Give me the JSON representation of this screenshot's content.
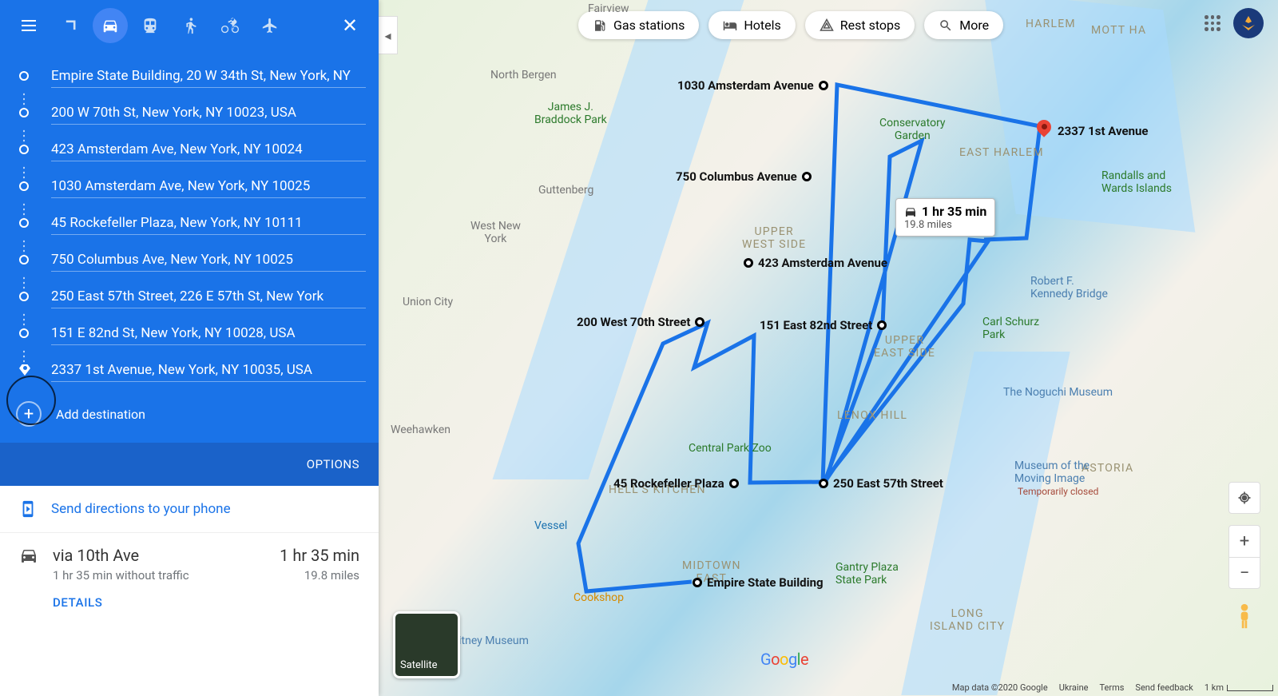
{
  "travel_modes": [
    "best",
    "driving",
    "transit",
    "walking",
    "cycling",
    "flights"
  ],
  "waypoints": [
    "Empire State Building, 20 W 34th St, New York, NY",
    "200 W 70th St, New York, NY 10023, USA",
    "423 Amsterdam Ave, New York, NY 10024",
    "1030 Amsterdam Ave, New York, NY 10025",
    "45 Rockefeller Plaza, New York, NY 10111",
    "750 Columbus Ave, New York, NY 10025",
    "250 East 57th Street, 226 E 57th St, New York",
    "151 E 82nd St, New York, NY 10028, USA",
    "2337 1st Avenue, New York, NY 10035, USA"
  ],
  "add_destination_label": "Add destination",
  "options_label": "OPTIONS",
  "send_label": "Send directions to your phone",
  "route": {
    "title": "via 10th Ave",
    "time": "1 hr 35 min",
    "subtitle": "1 hr 35 min without traffic",
    "distance": "19.8 miles",
    "details": "DETAILS"
  },
  "chips": {
    "gas": "Gas stations",
    "hotels": "Hotels",
    "rest": "Rest stops",
    "more": "More"
  },
  "map_labels": {
    "northbergen": "North Bergen",
    "unioncity": "Union City",
    "weehawken": "Weehawken",
    "guttenberg": "Guttenberg",
    "fairview": "Fairview",
    "westnewyork": "West New\nYork",
    "upperwest": "UPPER\nWEST SIDE",
    "uppereast": "UPPER\nEAST SIDE",
    "eastharlem": "EAST HARLEM",
    "midtowneast": "MIDTOWN\nEAST",
    "hellskitchen": "HELL'S KITCHEN",
    "lenoxhill": "LENOX HILL",
    "harlem": "HARLEM",
    "mottha": "MOTT HA",
    "astoria": "ASTORIA",
    "lic": "LONG\nISLAND CITY",
    "braddock": "James J.\nBraddock Park",
    "conservatory": "Conservatory\nGarden",
    "cpzoo": "Central Park Zoo",
    "vessel": "Vessel",
    "cookshop": "Cookshop",
    "rfk": "Robert F.\nKennedy Bridge",
    "carlschurz": "Carl Schurz\nPark",
    "noguchi": "The Noguchi Museum",
    "movingimage": "Museum of the\nMoving Image",
    "movingimage_sub": "Temporarily closed",
    "gantry": "Gantry Plaza\nState Park",
    "randalls": "Randalls and\nWards Islands",
    "whitney": "Whitney Museum"
  },
  "map_waypoints": {
    "empire": "Empire State Building",
    "w70": "200 West 70th Street",
    "amst423": "423 Amsterdam Avenue",
    "amst1030": "1030 Amsterdam Avenue",
    "rock45": "45 Rockefeller Plaza",
    "col750": "750 Columbus Avenue",
    "e57": "250 East 57th Street",
    "e82": "151 East 82nd Street",
    "first2337": "2337 1st Avenue"
  },
  "info_bubble": {
    "time": "1 hr 35 min",
    "dist": "19.8 miles"
  },
  "satellite_label": "Satellite",
  "attribution": {
    "data": "Map data ©2020 Google",
    "country": "Ukraine",
    "terms": "Terms",
    "feedback": "Send feedback",
    "scale": "1 km"
  }
}
